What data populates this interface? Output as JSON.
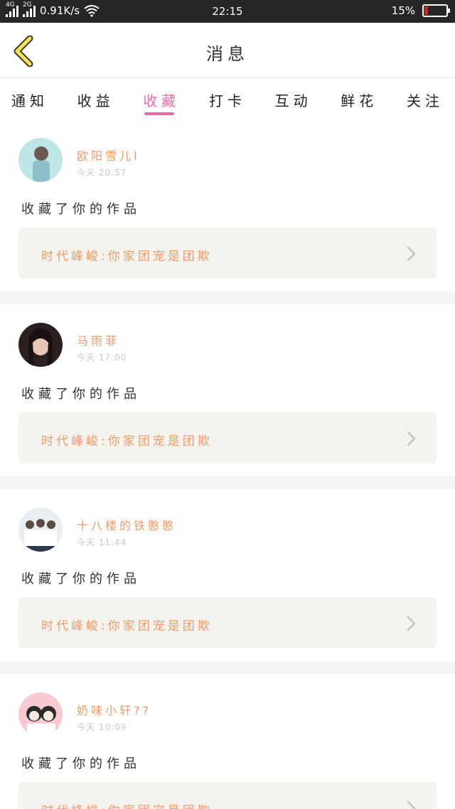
{
  "status_bar": {
    "network_1": "4G",
    "network_2": "2G",
    "speed": "0.91K/s",
    "time": "22:15",
    "battery_percent": "15%",
    "battery_level": 0.15
  },
  "nav": {
    "title": "消息"
  },
  "tabs": [
    {
      "label": "通知"
    },
    {
      "label": "收益"
    },
    {
      "label": "收藏"
    },
    {
      "label": "打卡"
    },
    {
      "label": "互动"
    },
    {
      "label": "鲜花"
    },
    {
      "label": "关注"
    }
  ],
  "active_tab": "收藏",
  "messages": [
    {
      "name": "欧阳雪儿l",
      "time": "今天 20:57",
      "action": "收藏了你的作品",
      "work_title": "时代峰峻:你家团宠是团欺"
    },
    {
      "name": "马雨菲",
      "time": "今天 17:00",
      "action": "收藏了你的作品",
      "work_title": "时代峰峻:你家团宠是团欺"
    },
    {
      "name": "十八楼的铁憨憨",
      "time": "今天 11:44",
      "action": "收藏了你的作品",
      "work_title": "时代峰峻:你家团宠是团欺"
    },
    {
      "name": "奶味小轩??",
      "time": "今天 10:09",
      "action": "收藏了你的作品",
      "work_title": "时代峰峻:你家团宠是团欺"
    }
  ],
  "colors": {
    "accent": "#e56ea7",
    "name_color": "#ee9b6e",
    "card_bg": "#f4f3ed"
  }
}
